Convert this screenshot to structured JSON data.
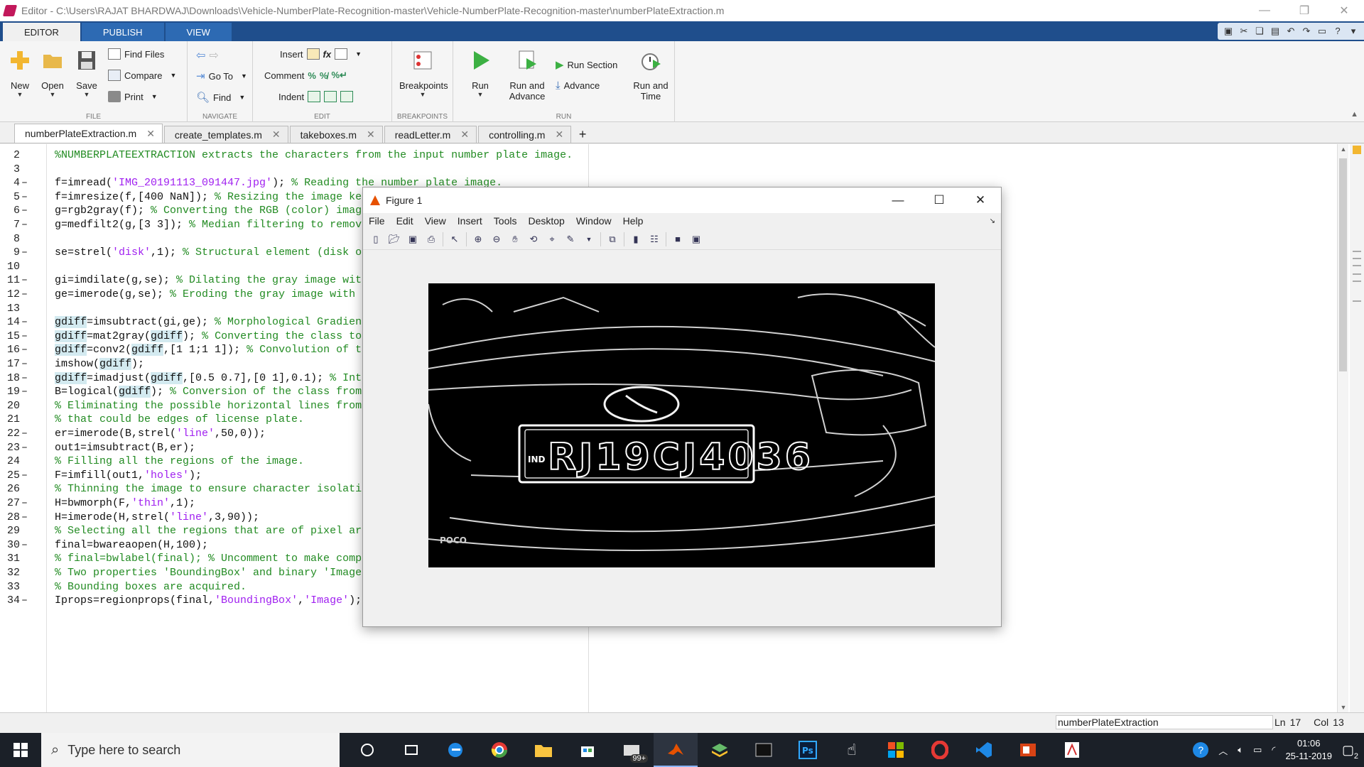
{
  "window": {
    "title": "Editor - C:\\Users\\RAJAT BHARDWAJ\\Downloads\\Vehicle-NumberPlate-Recognition-master\\Vehicle-NumberPlate-Recognition-master\\numberPlateExtraction.m",
    "minimize": "—",
    "restore": "❐",
    "close": "✕"
  },
  "ribbon_tabs": [
    "EDITOR",
    "PUBLISH",
    "VIEW"
  ],
  "ribbon": {
    "file": {
      "label": "FILE",
      "new": "New",
      "open": "Open",
      "save": "Save",
      "find_files": "Find Files",
      "compare": "Compare",
      "print": "Print"
    },
    "navigate": {
      "label": "NAVIGATE",
      "goto": "Go To",
      "find": "Find"
    },
    "edit": {
      "label": "EDIT",
      "insert": "Insert",
      "comment": "Comment",
      "indent": "Indent",
      "fx": "fx"
    },
    "breakpoints": {
      "label": "BREAKPOINTS",
      "button": "Breakpoints"
    },
    "run": {
      "label": "RUN",
      "run": "Run",
      "run_and_advance_1": "Run and",
      "run_and_advance_2": "Advance",
      "run_section": "Run Section",
      "advance": "Advance",
      "run_and_time_1": "Run and",
      "run_and_time_2": "Time"
    }
  },
  "file_tabs": [
    {
      "name": "numberPlateExtraction.m",
      "active": true
    },
    {
      "name": "create_templates.m",
      "active": false
    },
    {
      "name": "takeboxes.m",
      "active": false
    },
    {
      "name": "readLetter.m",
      "active": false
    },
    {
      "name": "controlling.m",
      "active": false
    }
  ],
  "tab_close": "✕",
  "tab_add": "+",
  "code_lines": [
    {
      "n": "2",
      "dash": "",
      "text": "%NUMBERPLATEEXTRACTION extracts the characters from the input number plate image."
    },
    {
      "n": "3",
      "dash": "",
      "text": ""
    },
    {
      "n": "4",
      "dash": "–",
      "text": "f=imread('IMG_20191113_091447.jpg'); % Reading the number plate image."
    },
    {
      "n": "5",
      "dash": "–",
      "text": "f=imresize(f,[400 NaN]); % Resizing the image keeping aspect ratio same."
    },
    {
      "n": "6",
      "dash": "–",
      "text": "g=rgb2gray(f); % Converting the RGB (color) image to gray (intensity)."
    },
    {
      "n": "7",
      "dash": "–",
      "text": "g=medfilt2(g,[3 3]); % Median filtering to remove noise."
    },
    {
      "n": "8",
      "dash": "",
      "text": ""
    },
    {
      "n": "9",
      "dash": "–",
      "text": "se=strel('disk',1); % Structural element (disk of radius 1) for morphological processing."
    },
    {
      "n": "10",
      "dash": "",
      "text": ""
    },
    {
      "n": "11",
      "dash": "–",
      "text": "gi=imdilate(g,se); % Dilating the gray image with the structural element."
    },
    {
      "n": "12",
      "dash": "–",
      "text": "ge=imerode(g,se); % Eroding the gray image with structural element."
    },
    {
      "n": "13",
      "dash": "",
      "text": ""
    },
    {
      "n": "14",
      "dash": "–",
      "text": "gdiff=imsubtract(gi,ge); % Morphological Gradient for edges enhancement."
    },
    {
      "n": "15",
      "dash": "–",
      "text": "gdiff=mat2gray(gdiff); % Converting the class to double."
    },
    {
      "n": "16",
      "dash": "–",
      "text": "gdiff=conv2(gdiff,[1 1;1 1]); % Convolution of the double image for brightening the edges."
    },
    {
      "n": "17",
      "dash": "–",
      "text": "imshow(gdiff);"
    },
    {
      "n": "18",
      "dash": "–",
      "text": "gdiff=imadjust(gdiff,[0.5 0.7],[0 1],0.1); % Intensity scaling between the range 0 to 1."
    },
    {
      "n": "19",
      "dash": "–",
      "text": "B=logical(gdiff); % Conversion of the class from double to binary."
    },
    {
      "n": "20",
      "dash": "",
      "text": "% Eliminating the possible horizontal lines from the output image of regiongrow"
    },
    {
      "n": "21",
      "dash": "",
      "text": "% that could be edges of license plate."
    },
    {
      "n": "22",
      "dash": "–",
      "text": "er=imerode(B,strel('line',50,0));"
    },
    {
      "n": "23",
      "dash": "–",
      "text": "out1=imsubtract(B,er);"
    },
    {
      "n": "24",
      "dash": "",
      "text": "% Filling all the regions of the image."
    },
    {
      "n": "25",
      "dash": "–",
      "text": "F=imfill(out1,'holes');"
    },
    {
      "n": "26",
      "dash": "",
      "text": "% Thinning the image to ensure character isolation."
    },
    {
      "n": "27",
      "dash": "–",
      "text": "H=bwmorph(F,'thin',1);"
    },
    {
      "n": "28",
      "dash": "–",
      "text": "H=imerode(H,strel('line',3,90));"
    },
    {
      "n": "29",
      "dash": "",
      "text": "% Selecting all the regions that are of pixel area more than 100."
    },
    {
      "n": "30",
      "dash": "–",
      "text": "final=bwareaopen(H,100);"
    },
    {
      "n": "31",
      "dash": "",
      "text": "% final=bwlabel(final); % Uncomment to make compitable with the previous versions of MATLAB®"
    },
    {
      "n": "32",
      "dash": "",
      "text": "% Two properties 'BoundingBox' and binary 'Image' corresponding to these"
    },
    {
      "n": "33",
      "dash": "",
      "text": "% Bounding boxes are acquired."
    },
    {
      "n": "34",
      "dash": "–",
      "text": "Iprops=regionprops(final,'BoundingBox','Image');"
    }
  ],
  "status": {
    "function_name": "numberPlateExtraction",
    "ln_label": "Ln",
    "ln": "17",
    "col_label": "Col",
    "col": "13"
  },
  "figure": {
    "title": "Figure 1",
    "menu": [
      "File",
      "Edit",
      "View",
      "Insert",
      "Tools",
      "Desktop",
      "Window",
      "Help"
    ],
    "plate_text": "RJ19CJ4036",
    "plate_prefix": "IND",
    "watermark": "POCO"
  },
  "taskbar": {
    "search_placeholder": "Type here to search",
    "mail_badge": "99+",
    "time": "01:06",
    "date": "25-11-2019",
    "notif_count": "2"
  },
  "colors": {
    "ribbon_blue": "#1f4e8c",
    "comment": "#228b22",
    "string": "#a020f0",
    "highlight": "#d3eaf0"
  }
}
